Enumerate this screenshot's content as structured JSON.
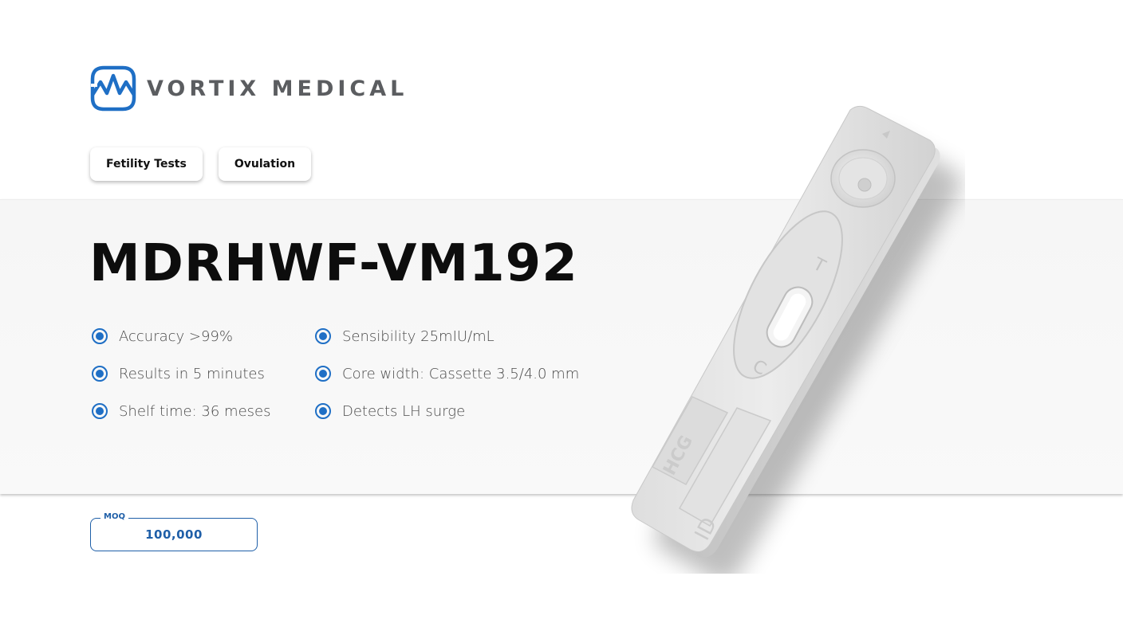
{
  "brand": {
    "name": "VORTIX MEDICAL",
    "accent": "#1f6fc5",
    "text_color": "#5b5d60"
  },
  "tags": [
    {
      "label": "Fetility Tests"
    },
    {
      "label": "Ovulation"
    }
  ],
  "product": {
    "title": "MDRHWF-VM192",
    "features": [
      {
        "text": "Accuracy >99%"
      },
      {
        "text": "Sensibility 25mIU/mL"
      },
      {
        "text": "Results in 5 minutes"
      },
      {
        "text": "Core width: Cassette 3.5/4.0 mm"
      },
      {
        "text": "Shelf time: 36 meses"
      },
      {
        "text": "Detects LH surge"
      }
    ],
    "moq": {
      "label": "MOQ",
      "value": "100,000"
    }
  },
  "device": {
    "icon": "test-cassette-image",
    "markings": {
      "t": "T",
      "c": "C",
      "hcg": "HCG",
      "id": "ID"
    }
  }
}
